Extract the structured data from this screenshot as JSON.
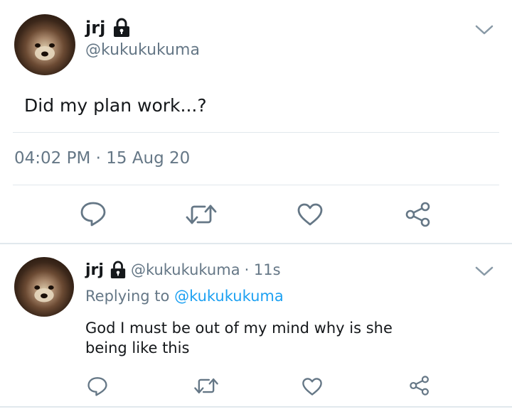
{
  "main_tweet": {
    "display_name": "jrj",
    "handle": "@kukukukuma",
    "text": "Did my plan work...?",
    "timestamp": "04:02 PM · 15 Aug 20"
  },
  "reply_tweet": {
    "display_name": "jrj",
    "handle": "@kukukukuma",
    "time_ago": "· 11s",
    "replying_prefix": "Replying to",
    "replying_handle": "@kukukukuma",
    "text_line1": "God I must be out of my mind why is she",
    "text_line2": "being like this"
  },
  "icons": {
    "lock": "lock-icon",
    "chevron": "chevron-down-icon",
    "reply": "comment-icon",
    "retweet": "retweet-icon",
    "like": "heart-icon",
    "share": "share-icon"
  },
  "colors": {
    "text": "#14171a",
    "muted": "#657786",
    "link": "#1da1f2",
    "divider": "#e1e8ed"
  }
}
